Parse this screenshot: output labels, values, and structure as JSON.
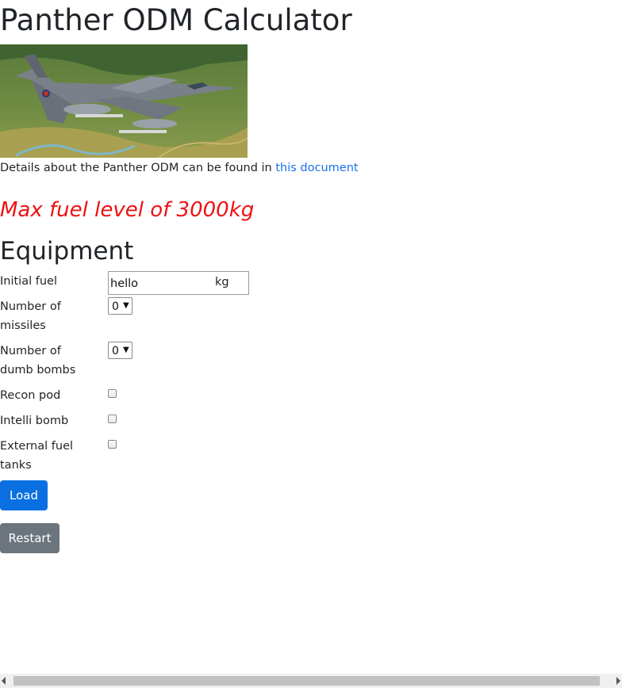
{
  "page": {
    "title": "Panther ODM Calculator"
  },
  "hero_image": {
    "icon": "jet-aircraft-photo"
  },
  "details": {
    "text": "Details about the Panther ODM can be found in ",
    "link_text": "this document"
  },
  "max_fuel": {
    "text": "Max fuel level of 3000kg",
    "color": "#ee1111"
  },
  "equipment": {
    "heading": "Equipment",
    "initial_fuel": {
      "label": "Initial fuel",
      "value": "hello",
      "unit": "kg"
    },
    "missiles": {
      "label": "Number of missiles",
      "value": "0"
    },
    "dumb_bombs": {
      "label": "Number of dumb bombs",
      "value": "0"
    },
    "recon_pod": {
      "label": "Recon pod",
      "checked": false
    },
    "intelli_bomb": {
      "label": "Intelli bomb",
      "checked": false
    },
    "external_fuel_tanks": {
      "label": "External fuel tanks",
      "checked": false
    }
  },
  "buttons": {
    "load": "Load",
    "restart": "Restart",
    "load_color": "#0a6fe0",
    "restart_color": "#6c757d"
  },
  "scrollbar": {
    "orientation": "horizontal"
  }
}
